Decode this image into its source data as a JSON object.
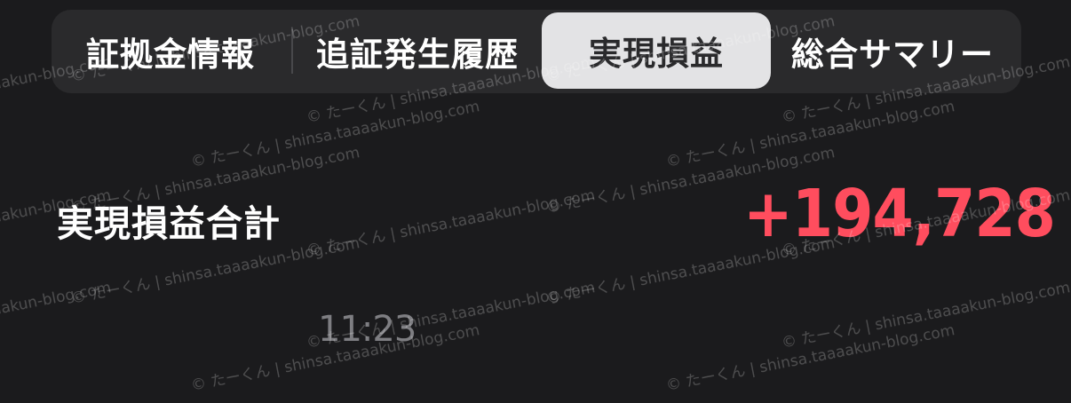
{
  "tabs": [
    {
      "label": "証拠金情報",
      "selected": false
    },
    {
      "label": "追証発生履歴",
      "selected": false
    },
    {
      "label": "実現損益",
      "selected": true
    },
    {
      "label": "総合サマリー",
      "selected": false
    }
  ],
  "summary": {
    "label": "実現損益合計",
    "value": "+194,728",
    "value_color": "#ff4d5e"
  },
  "timestamp": "11:23",
  "watermark": {
    "text_a": "© たーくん | shinsa.taaaakun-blog.com"
  }
}
